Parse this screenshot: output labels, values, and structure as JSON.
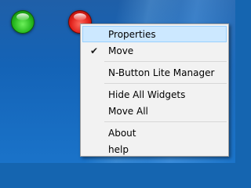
{
  "desktop": {
    "widgets": [
      {
        "name": "green-widget",
        "color": "#23b51c"
      },
      {
        "name": "red-widget",
        "color": "#e0201a"
      }
    ],
    "background_color": "#1565b0"
  },
  "context_menu": {
    "highlight_color": "#cce8ff",
    "groups": [
      [
        {
          "label": "Properties",
          "highlighted": true
        },
        {
          "label": "Move",
          "checked": true,
          "check_glyph": "✔"
        }
      ],
      [
        {
          "label": "N-Button Lite Manager"
        }
      ],
      [
        {
          "label": "Hide All Widgets"
        },
        {
          "label": "Move All"
        }
      ],
      [
        {
          "label": "About"
        },
        {
          "label": "help"
        }
      ]
    ]
  }
}
